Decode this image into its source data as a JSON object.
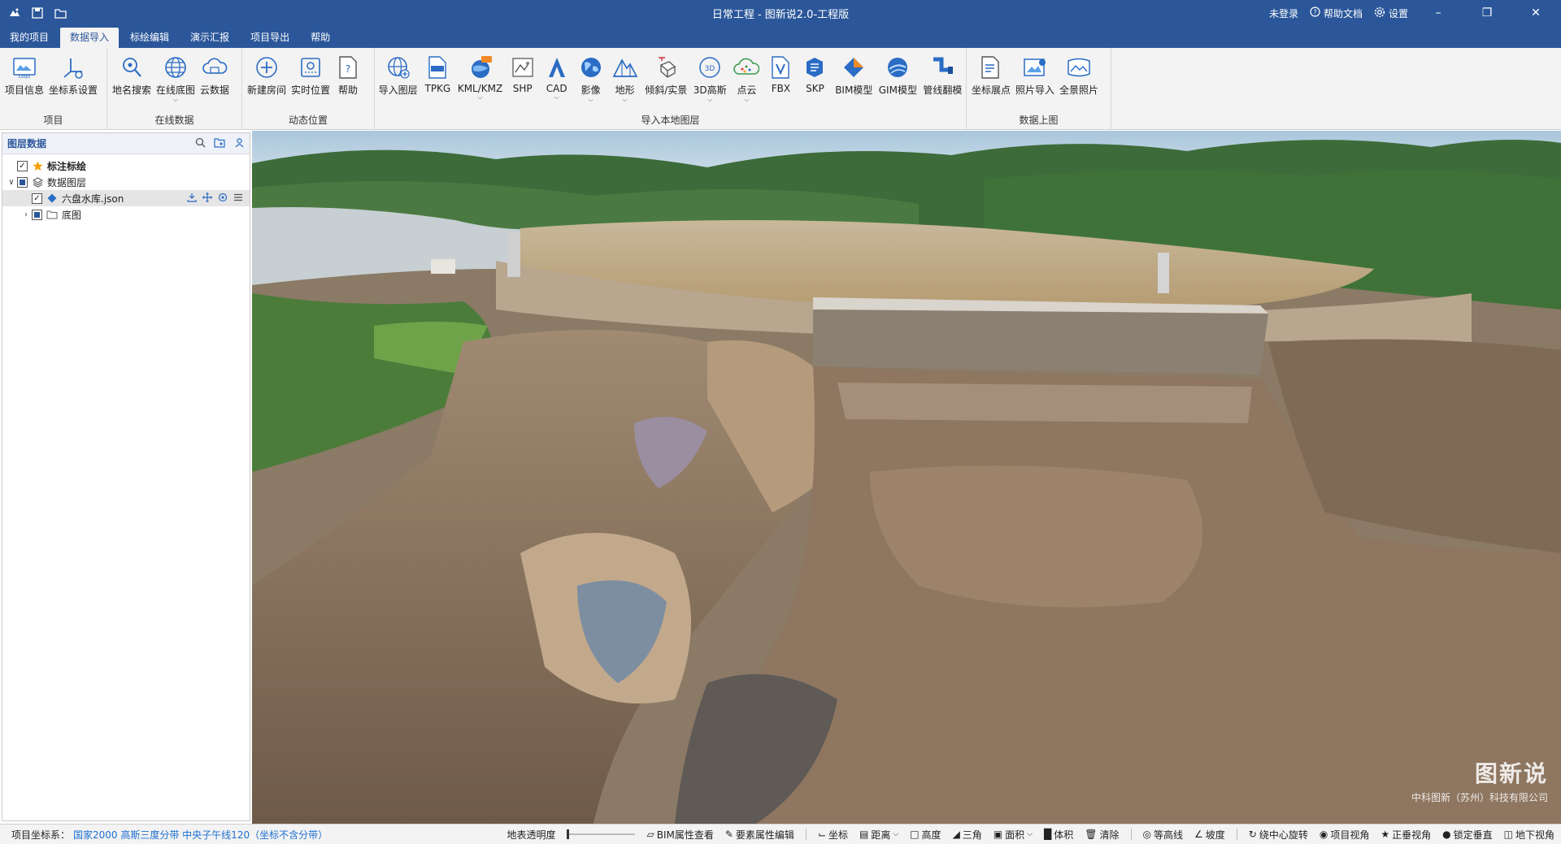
{
  "titlebar": {
    "title": "日常工程 - 图新说2.0-工程版",
    "login": "未登录",
    "help_doc": "帮助文档",
    "settings": "设置"
  },
  "menu": [
    "我的项目",
    "数据导入",
    "标绘编辑",
    "演示汇报",
    "项目导出",
    "帮助"
  ],
  "ribbon": {
    "groups": [
      {
        "label": "项目",
        "items": [
          "项目信息",
          "坐标系设置"
        ]
      },
      {
        "label": "在线数据",
        "items": [
          "地名搜索",
          "在线底图",
          "云数据"
        ]
      },
      {
        "label": "动态位置",
        "items": [
          "新建房间",
          "实时位置",
          "帮助"
        ]
      },
      {
        "label": "导入本地图层",
        "items": [
          "导入图层",
          "TPKG",
          "KML/KMZ",
          "SHP",
          "CAD",
          "影像",
          "地形",
          "倾斜/实景",
          "3D高斯",
          "点云",
          "FBX",
          "SKP",
          "BIM模型",
          "GIM模型",
          "管线翻模"
        ]
      },
      {
        "label": "数据上图",
        "items": [
          "坐标展点",
          "照片导入",
          "全景照片"
        ]
      }
    ]
  },
  "panel": {
    "title": "图层数据",
    "tree": [
      {
        "label": "标注标绘"
      },
      {
        "label": "数据图层"
      },
      {
        "label": "六盘水库.json"
      },
      {
        "label": "底图"
      }
    ]
  },
  "watermark": {
    "main": "图新说",
    "sub": "中科图新（苏州）科技有限公司"
  },
  "status": {
    "coord_label": "项目坐标系：",
    "coord_value": "国家2000 高斯三度分带 中央子午线120（坐标不含分带）",
    "opacity_label": "地表透明度",
    "opacity_value": 0,
    "tools": [
      "BIM属性查看",
      "要素属性编辑",
      "坐标",
      "距离",
      "高度",
      "三角",
      "面积",
      "体积",
      "清除",
      "等高线",
      "坡度",
      "绕中心旋转",
      "项目视角",
      "正垂视角",
      "锁定垂直",
      "地下视角"
    ]
  },
  "colors": {
    "brand": "#2b579a",
    "coord_text": "#1d6fd1"
  }
}
